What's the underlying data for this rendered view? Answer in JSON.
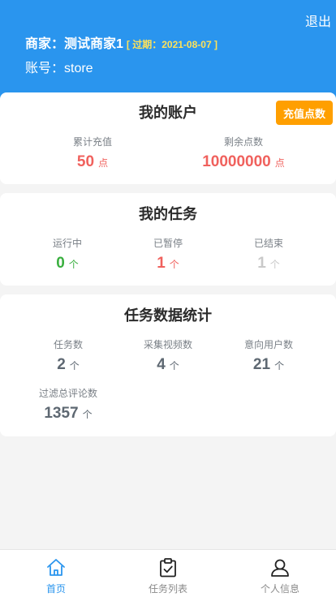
{
  "header": {
    "logout": "退出",
    "merchant": "商家：测试商家1",
    "expire": "[ 过期：2021-08-07 ]",
    "account": "账号：store"
  },
  "account_card": {
    "title": "我的账户",
    "recharge_button": "充值点数",
    "stats": [
      {
        "label": "累计充值",
        "value": "50",
        "unit": "点"
      },
      {
        "label": "剩余点数",
        "value": "10000000",
        "unit": "点"
      }
    ]
  },
  "tasks_card": {
    "title": "我的任务",
    "stats": [
      {
        "label": "运行中",
        "value": "0",
        "unit": "个"
      },
      {
        "label": "已暂停",
        "value": "1",
        "unit": "个"
      },
      {
        "label": "已结束",
        "value": "1",
        "unit": "个"
      }
    ]
  },
  "stats_card": {
    "title": "任务数据统计",
    "stats": [
      {
        "label": "任务数",
        "value": "2",
        "unit": "个"
      },
      {
        "label": "采集视频数",
        "value": "4",
        "unit": "个"
      },
      {
        "label": "意向用户数",
        "value": "21",
        "unit": "个"
      },
      {
        "label": "过滤总评论数",
        "value": "1357",
        "unit": "个"
      }
    ]
  },
  "tabbar": {
    "items": [
      {
        "label": "首页",
        "icon": "home-icon",
        "active": true
      },
      {
        "label": "任务列表",
        "icon": "clipboard-check-icon",
        "active": false
      },
      {
        "label": "个人信息",
        "icon": "user-icon",
        "active": false
      }
    ]
  },
  "colors": {
    "header_bg": "#2a95ee",
    "recharge_button": "#ff9f00",
    "expire_text": "#ffe259",
    "value_red": "#f0615d",
    "value_green": "#3aaf3f",
    "value_grey": "#c9c9c9",
    "value_slate": "#5e6872"
  }
}
